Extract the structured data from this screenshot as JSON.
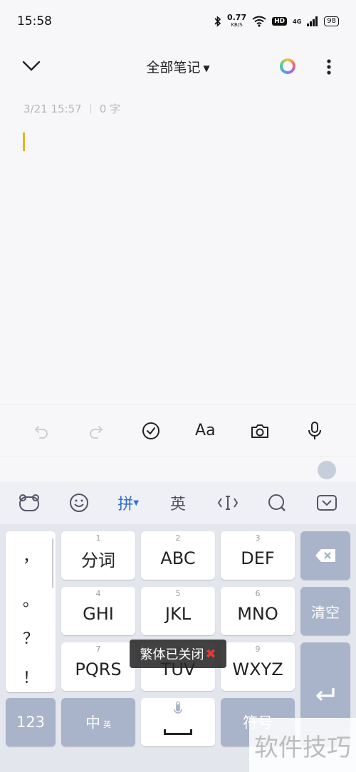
{
  "status": {
    "time": "15:58",
    "net_speed": "0.77",
    "net_unit": "KB/S",
    "hd": "HD",
    "signal_label": "4G",
    "battery": "98"
  },
  "header": {
    "title": "全部笔记"
  },
  "note": {
    "date": "3/21 15:57",
    "word_count": "0 字"
  },
  "toolbar": {
    "format_label": "Aa"
  },
  "ime": {
    "pinyin": "拼",
    "english": "英"
  },
  "keyboard": {
    "punct": [
      "，",
      "。",
      "？",
      "！"
    ],
    "keys": [
      {
        "num": "1",
        "label": "分词"
      },
      {
        "num": "2",
        "label": "ABC"
      },
      {
        "num": "3",
        "label": "DEF"
      },
      {
        "num": "4",
        "label": "GHI"
      },
      {
        "num": "5",
        "label": "JKL"
      },
      {
        "num": "6",
        "label": "MNO"
      },
      {
        "num": "7",
        "label": "PQRS"
      },
      {
        "num": "8",
        "label": "TUV"
      },
      {
        "num": "9",
        "label": "WXYZ"
      }
    ],
    "clear": "清空",
    "num_key": "123",
    "cn_key": "中",
    "cn_sub": "英",
    "zero": "0",
    "symbol_key": "符号"
  },
  "toast": {
    "text": "繁体已关闭"
  },
  "watermark": "软件技巧",
  "colors": {
    "accent": "#2f6fd3",
    "cursor": "#e2b51b",
    "func_key": "#a9b4ca"
  }
}
